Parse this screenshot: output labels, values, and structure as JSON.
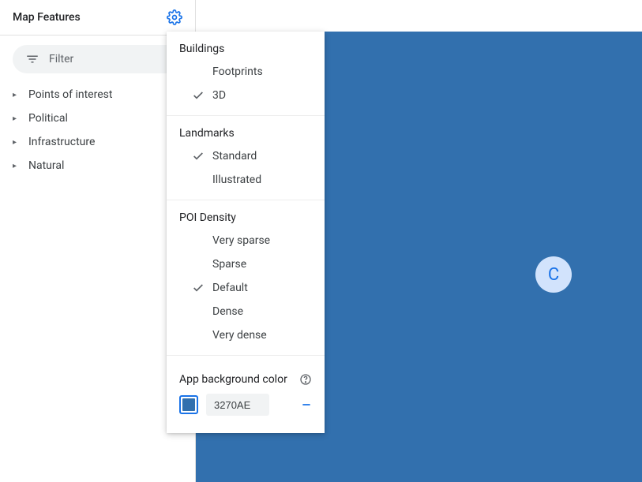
{
  "sidebar": {
    "title": "Map Features",
    "filter_placeholder": "Filter",
    "items": [
      {
        "label": "Points of interest"
      },
      {
        "label": "Political"
      },
      {
        "label": "Infrastructure"
      },
      {
        "label": "Natural"
      }
    ]
  },
  "popover": {
    "sections": [
      {
        "title": "Buildings",
        "options": [
          {
            "label": "Footprints",
            "selected": false
          },
          {
            "label": "3D",
            "selected": true
          }
        ]
      },
      {
        "title": "Landmarks",
        "options": [
          {
            "label": "Standard",
            "selected": true
          },
          {
            "label": "Illustrated",
            "selected": false
          }
        ]
      },
      {
        "title": "POI Density",
        "options": [
          {
            "label": "Very sparse",
            "selected": false
          },
          {
            "label": "Sparse",
            "selected": false
          },
          {
            "label": "Default",
            "selected": true
          },
          {
            "label": "Dense",
            "selected": false
          },
          {
            "label": "Very dense",
            "selected": false
          }
        ]
      }
    ],
    "bg_color_label": "App background color",
    "bg_color_hex": "3270AE"
  },
  "canvas": {
    "badge_letter": "C",
    "background_color": "#3270AE"
  }
}
